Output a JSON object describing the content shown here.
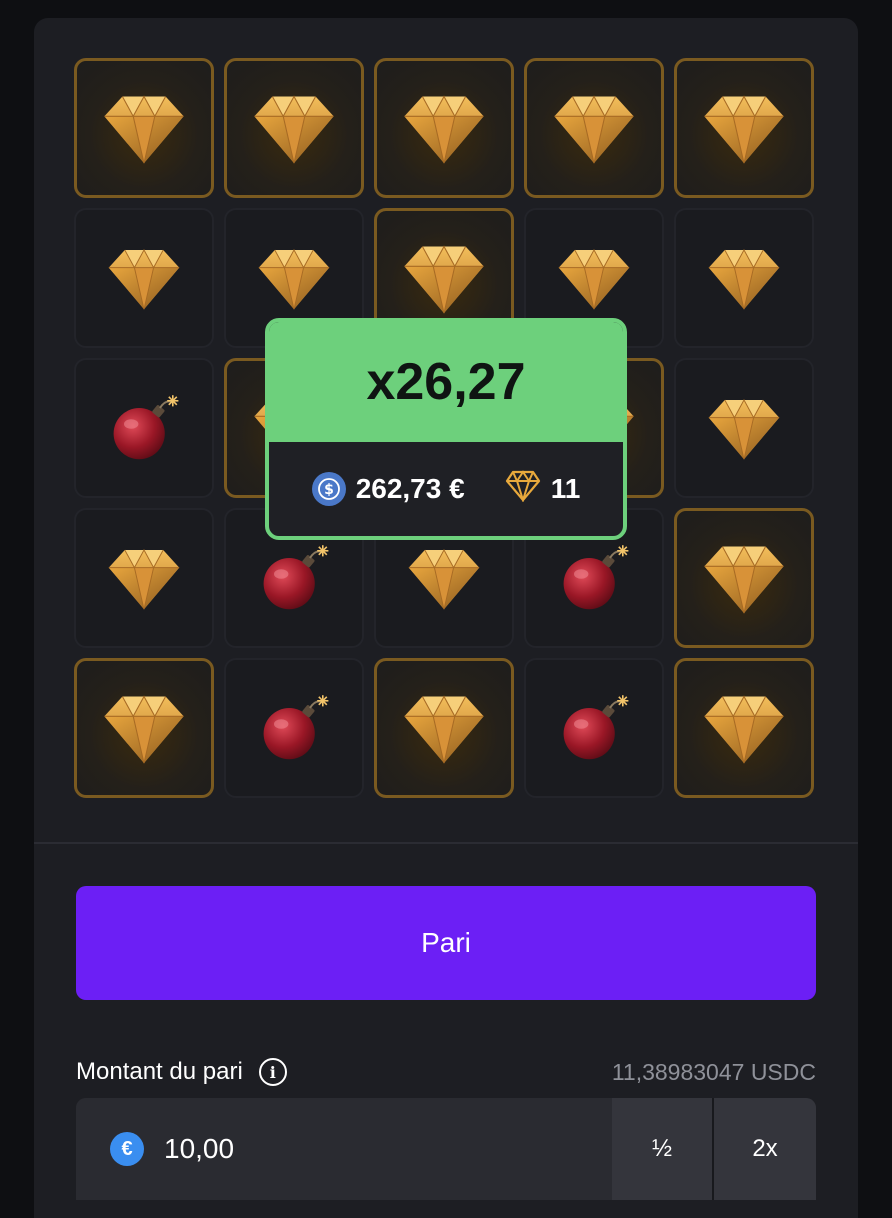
{
  "board": {
    "size": 5,
    "tiles": [
      {
        "type": "gem",
        "revealed": true
      },
      {
        "type": "gem",
        "revealed": true
      },
      {
        "type": "gem",
        "revealed": true
      },
      {
        "type": "gem",
        "revealed": true
      },
      {
        "type": "gem",
        "revealed": true
      },
      {
        "type": "gem",
        "revealed": false
      },
      {
        "type": "gem",
        "revealed": false
      },
      {
        "type": "gem",
        "revealed": true
      },
      {
        "type": "gem",
        "revealed": false
      },
      {
        "type": "gem",
        "revealed": false
      },
      {
        "type": "bomb",
        "revealed": false
      },
      {
        "type": "gem",
        "revealed": true
      },
      {
        "type": "gem",
        "revealed": false
      },
      {
        "type": "gem",
        "revealed": true
      },
      {
        "type": "gem",
        "revealed": false
      },
      {
        "type": "gem",
        "revealed": false
      },
      {
        "type": "bomb",
        "revealed": false
      },
      {
        "type": "gem",
        "revealed": false
      },
      {
        "type": "bomb",
        "revealed": false
      },
      {
        "type": "gem",
        "revealed": true
      },
      {
        "type": "gem",
        "revealed": true
      },
      {
        "type": "bomb",
        "revealed": false
      },
      {
        "type": "gem",
        "revealed": true
      },
      {
        "type": "bomb",
        "revealed": false
      },
      {
        "type": "gem",
        "revealed": true
      }
    ]
  },
  "result": {
    "multiplier": "x26,27",
    "payout": "262,73 €",
    "gems_found": "11",
    "payout_icon": "usdc-coin-icon",
    "gems_icon": "diamond-icon"
  },
  "controls": {
    "bet_button_label": "Pari",
    "bet_amount_label": "Montant du pari",
    "balance": "11,38983047 USDC",
    "bet_amount_value": "10,00",
    "currency_symbol": "€",
    "half_label": "½",
    "double_label": "2x"
  },
  "colors": {
    "win_green": "#6dd07c",
    "bet_button": "#6c1ff5",
    "gem_gold": "#e0a23a",
    "bomb_red": "#b01e2c"
  }
}
